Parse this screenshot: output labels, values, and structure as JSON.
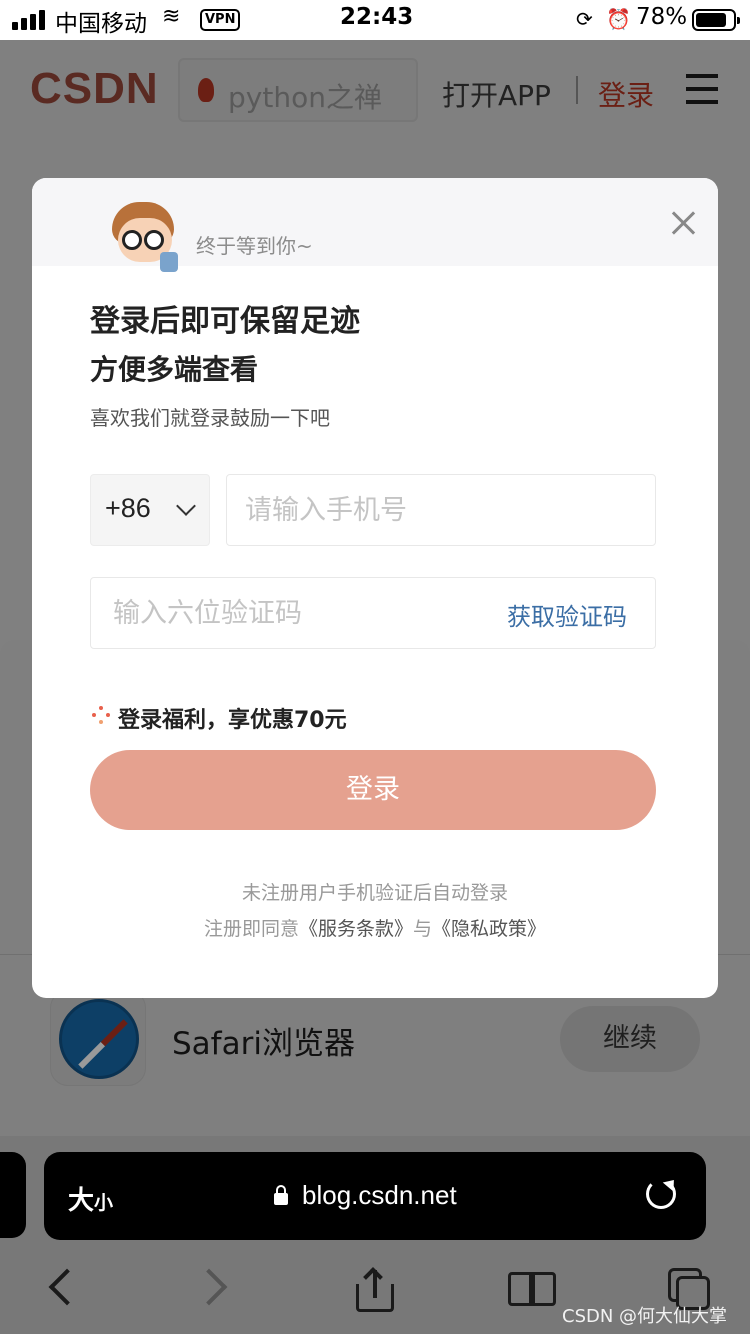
{
  "status_bar": {
    "carrier": "中国移动",
    "vpn": "VPN",
    "time": "22:43",
    "battery": "78%"
  },
  "header": {
    "logo": "CSDN",
    "search_text": "python之禅",
    "open_app": "打开APP",
    "login": "登录"
  },
  "modal": {
    "greeting": "终于等到你~",
    "title_line1": "登录后即可保留足迹",
    "title_line2": "方便多端查看",
    "subtitle": "喜欢我们就登录鼓励一下吧",
    "country_code": "+86",
    "phone_placeholder": "请输入手机号",
    "code_placeholder": "输入六位验证码",
    "get_code": "获取验证码",
    "benefit": "登录福利，享优惠70元",
    "login_button": "登录",
    "note": "未注册用户手机验证后自动登录",
    "agree_prefix": "注册即同意",
    "terms": "《服务条款》",
    "agree_and": "与",
    "privacy": "《隐私政策》"
  },
  "app_sheet": {
    "browser_name": "Safari浏览器",
    "continue": "继续"
  },
  "safari": {
    "text_size": "大",
    "text_size_small": "小",
    "url": "blog.csdn.net"
  },
  "watermark": "CSDN @何大仙大掌",
  "colors": {
    "accent": "#e5a18f",
    "link": "#3b6ea5",
    "overlay": "#808080"
  }
}
